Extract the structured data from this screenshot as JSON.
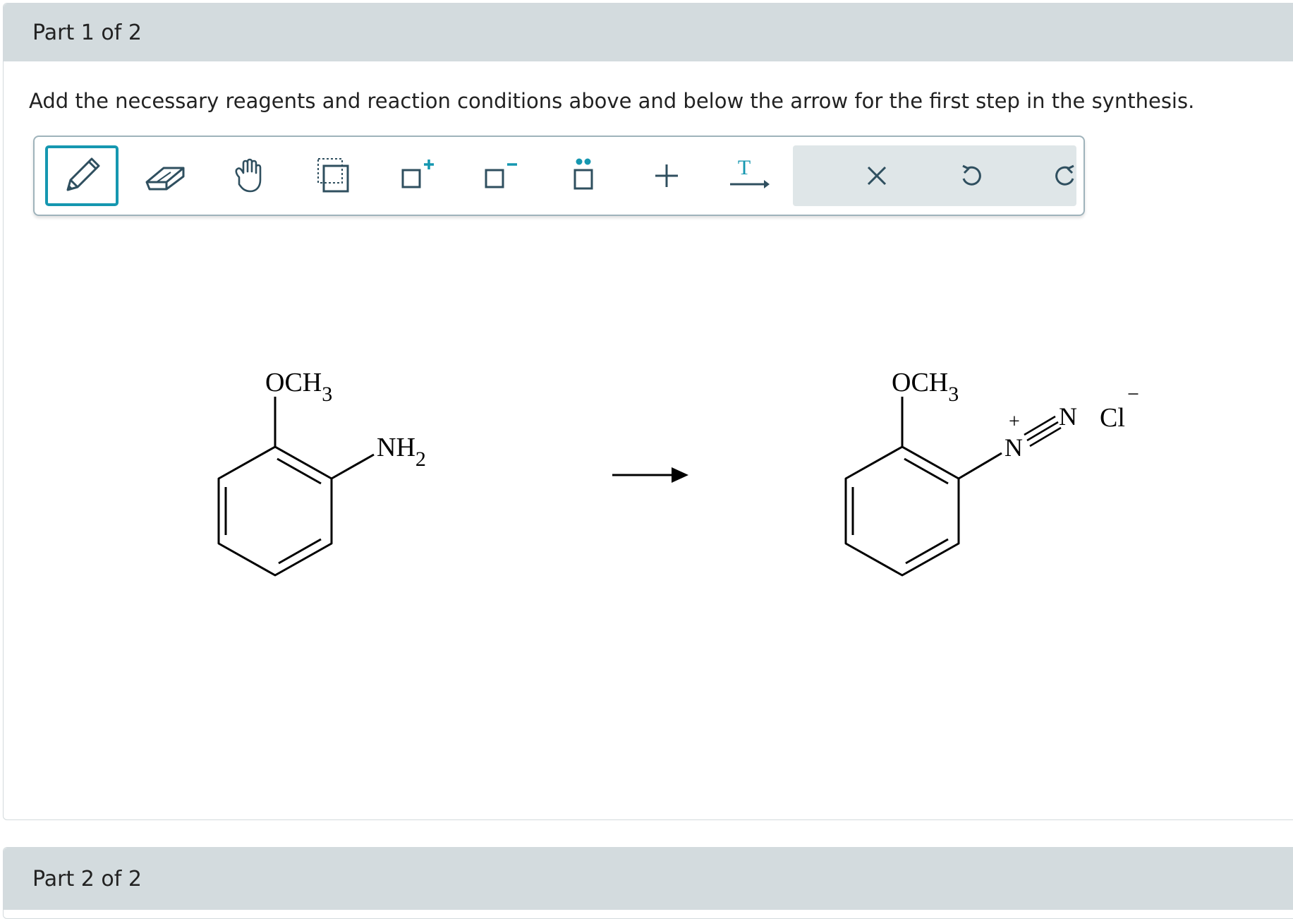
{
  "part1": {
    "header": "Part 1 of 2",
    "instructions": "Add the necessary reagents and reaction conditions above and below the arrow for the first step in the synthesis."
  },
  "toolbar": {
    "tools": [
      {
        "name": "draw-tool",
        "icon": "pencil-icon",
        "selected": true
      },
      {
        "name": "erase-tool",
        "icon": "eraser-icon",
        "selected": false
      },
      {
        "name": "move-tool",
        "icon": "hand-icon",
        "selected": false
      },
      {
        "name": "select-tool",
        "icon": "selection-box-icon",
        "selected": false
      },
      {
        "name": "positive-charge-tool",
        "icon": "plus-charge-icon",
        "selected": false
      },
      {
        "name": "negative-charge-tool",
        "icon": "minus-charge-icon",
        "selected": false
      },
      {
        "name": "lone-pair-tool",
        "icon": "lone-pair-icon",
        "selected": false
      },
      {
        "name": "add-reactant-tool",
        "icon": "plus-icon",
        "selected": false
      },
      {
        "name": "reaction-conditions-tool",
        "icon": "text-arrow-icon",
        "text_glyph": "T",
        "selected": false
      }
    ],
    "actions": [
      {
        "name": "clear-button",
        "icon": "close-icon"
      },
      {
        "name": "undo-button",
        "icon": "undo-icon"
      },
      {
        "name": "redo-button",
        "icon": "redo-icon"
      }
    ],
    "colors": {
      "accent": "#1597b0",
      "icon": "#2f4f5f",
      "action_bg": "#dfe6e8"
    }
  },
  "reaction": {
    "reactant": {
      "substituent_top": {
        "main": "OCH",
        "sub": "3"
      },
      "substituent_side": {
        "main": "NH",
        "sub": "2"
      }
    },
    "product": {
      "substituent_top": {
        "main": "OCH",
        "sub": "3"
      },
      "diazonium": {
        "n1": "N",
        "n1_charge": "+",
        "n2": "N"
      },
      "counterion": {
        "symbol": "Cl",
        "charge": "−"
      }
    }
  },
  "part2": {
    "header": "Part 2 of 2"
  }
}
